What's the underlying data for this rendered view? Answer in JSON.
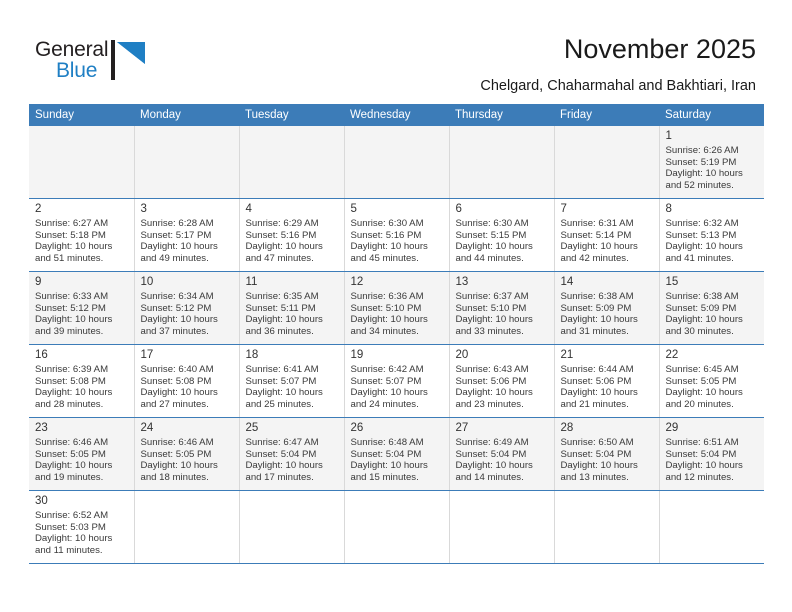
{
  "brand": {
    "name_part1": "General",
    "name_part2": "Blue",
    "accent_color": "#1f7fc4"
  },
  "header": {
    "title": "November 2025",
    "subtitle": "Chelgard, Chaharmahal and Bakhtiari, Iran"
  },
  "calendar": {
    "header_bg": "#3c7cb8",
    "weekdays": [
      "Sunday",
      "Monday",
      "Tuesday",
      "Wednesday",
      "Thursday",
      "Friday",
      "Saturday"
    ],
    "weeks": [
      [
        null,
        null,
        null,
        null,
        null,
        null,
        {
          "day": "1",
          "sunrise": "Sunrise: 6:26 AM",
          "sunset": "Sunset: 5:19 PM",
          "daylight_line1": "Daylight: 10 hours",
          "daylight_line2": "and 52 minutes."
        }
      ],
      [
        {
          "day": "2",
          "sunrise": "Sunrise: 6:27 AM",
          "sunset": "Sunset: 5:18 PM",
          "daylight_line1": "Daylight: 10 hours",
          "daylight_line2": "and 51 minutes."
        },
        {
          "day": "3",
          "sunrise": "Sunrise: 6:28 AM",
          "sunset": "Sunset: 5:17 PM",
          "daylight_line1": "Daylight: 10 hours",
          "daylight_line2": "and 49 minutes."
        },
        {
          "day": "4",
          "sunrise": "Sunrise: 6:29 AM",
          "sunset": "Sunset: 5:16 PM",
          "daylight_line1": "Daylight: 10 hours",
          "daylight_line2": "and 47 minutes."
        },
        {
          "day": "5",
          "sunrise": "Sunrise: 6:30 AM",
          "sunset": "Sunset: 5:16 PM",
          "daylight_line1": "Daylight: 10 hours",
          "daylight_line2": "and 45 minutes."
        },
        {
          "day": "6",
          "sunrise": "Sunrise: 6:30 AM",
          "sunset": "Sunset: 5:15 PM",
          "daylight_line1": "Daylight: 10 hours",
          "daylight_line2": "and 44 minutes."
        },
        {
          "day": "7",
          "sunrise": "Sunrise: 6:31 AM",
          "sunset": "Sunset: 5:14 PM",
          "daylight_line1": "Daylight: 10 hours",
          "daylight_line2": "and 42 minutes."
        },
        {
          "day": "8",
          "sunrise": "Sunrise: 6:32 AM",
          "sunset": "Sunset: 5:13 PM",
          "daylight_line1": "Daylight: 10 hours",
          "daylight_line2": "and 41 minutes."
        }
      ],
      [
        {
          "day": "9",
          "sunrise": "Sunrise: 6:33 AM",
          "sunset": "Sunset: 5:12 PM",
          "daylight_line1": "Daylight: 10 hours",
          "daylight_line2": "and 39 minutes."
        },
        {
          "day": "10",
          "sunrise": "Sunrise: 6:34 AM",
          "sunset": "Sunset: 5:12 PM",
          "daylight_line1": "Daylight: 10 hours",
          "daylight_line2": "and 37 minutes."
        },
        {
          "day": "11",
          "sunrise": "Sunrise: 6:35 AM",
          "sunset": "Sunset: 5:11 PM",
          "daylight_line1": "Daylight: 10 hours",
          "daylight_line2": "and 36 minutes."
        },
        {
          "day": "12",
          "sunrise": "Sunrise: 6:36 AM",
          "sunset": "Sunset: 5:10 PM",
          "daylight_line1": "Daylight: 10 hours",
          "daylight_line2": "and 34 minutes."
        },
        {
          "day": "13",
          "sunrise": "Sunrise: 6:37 AM",
          "sunset": "Sunset: 5:10 PM",
          "daylight_line1": "Daylight: 10 hours",
          "daylight_line2": "and 33 minutes."
        },
        {
          "day": "14",
          "sunrise": "Sunrise: 6:38 AM",
          "sunset": "Sunset: 5:09 PM",
          "daylight_line1": "Daylight: 10 hours",
          "daylight_line2": "and 31 minutes."
        },
        {
          "day": "15",
          "sunrise": "Sunrise: 6:38 AM",
          "sunset": "Sunset: 5:09 PM",
          "daylight_line1": "Daylight: 10 hours",
          "daylight_line2": "and 30 minutes."
        }
      ],
      [
        {
          "day": "16",
          "sunrise": "Sunrise: 6:39 AM",
          "sunset": "Sunset: 5:08 PM",
          "daylight_line1": "Daylight: 10 hours",
          "daylight_line2": "and 28 minutes."
        },
        {
          "day": "17",
          "sunrise": "Sunrise: 6:40 AM",
          "sunset": "Sunset: 5:08 PM",
          "daylight_line1": "Daylight: 10 hours",
          "daylight_line2": "and 27 minutes."
        },
        {
          "day": "18",
          "sunrise": "Sunrise: 6:41 AM",
          "sunset": "Sunset: 5:07 PM",
          "daylight_line1": "Daylight: 10 hours",
          "daylight_line2": "and 25 minutes."
        },
        {
          "day": "19",
          "sunrise": "Sunrise: 6:42 AM",
          "sunset": "Sunset: 5:07 PM",
          "daylight_line1": "Daylight: 10 hours",
          "daylight_line2": "and 24 minutes."
        },
        {
          "day": "20",
          "sunrise": "Sunrise: 6:43 AM",
          "sunset": "Sunset: 5:06 PM",
          "daylight_line1": "Daylight: 10 hours",
          "daylight_line2": "and 23 minutes."
        },
        {
          "day": "21",
          "sunrise": "Sunrise: 6:44 AM",
          "sunset": "Sunset: 5:06 PM",
          "daylight_line1": "Daylight: 10 hours",
          "daylight_line2": "and 21 minutes."
        },
        {
          "day": "22",
          "sunrise": "Sunrise: 6:45 AM",
          "sunset": "Sunset: 5:05 PM",
          "daylight_line1": "Daylight: 10 hours",
          "daylight_line2": "and 20 minutes."
        }
      ],
      [
        {
          "day": "23",
          "sunrise": "Sunrise: 6:46 AM",
          "sunset": "Sunset: 5:05 PM",
          "daylight_line1": "Daylight: 10 hours",
          "daylight_line2": "and 19 minutes."
        },
        {
          "day": "24",
          "sunrise": "Sunrise: 6:46 AM",
          "sunset": "Sunset: 5:05 PM",
          "daylight_line1": "Daylight: 10 hours",
          "daylight_line2": "and 18 minutes."
        },
        {
          "day": "25",
          "sunrise": "Sunrise: 6:47 AM",
          "sunset": "Sunset: 5:04 PM",
          "daylight_line1": "Daylight: 10 hours",
          "daylight_line2": "and 17 minutes."
        },
        {
          "day": "26",
          "sunrise": "Sunrise: 6:48 AM",
          "sunset": "Sunset: 5:04 PM",
          "daylight_line1": "Daylight: 10 hours",
          "daylight_line2": "and 15 minutes."
        },
        {
          "day": "27",
          "sunrise": "Sunrise: 6:49 AM",
          "sunset": "Sunset: 5:04 PM",
          "daylight_line1": "Daylight: 10 hours",
          "daylight_line2": "and 14 minutes."
        },
        {
          "day": "28",
          "sunrise": "Sunrise: 6:50 AM",
          "sunset": "Sunset: 5:04 PM",
          "daylight_line1": "Daylight: 10 hours",
          "daylight_line2": "and 13 minutes."
        },
        {
          "day": "29",
          "sunrise": "Sunrise: 6:51 AM",
          "sunset": "Sunset: 5:04 PM",
          "daylight_line1": "Daylight: 10 hours",
          "daylight_line2": "and 12 minutes."
        }
      ],
      [
        {
          "day": "30",
          "sunrise": "Sunrise: 6:52 AM",
          "sunset": "Sunset: 5:03 PM",
          "daylight_line1": "Daylight: 10 hours",
          "daylight_line2": "and 11 minutes."
        },
        null,
        null,
        null,
        null,
        null,
        null
      ]
    ]
  }
}
